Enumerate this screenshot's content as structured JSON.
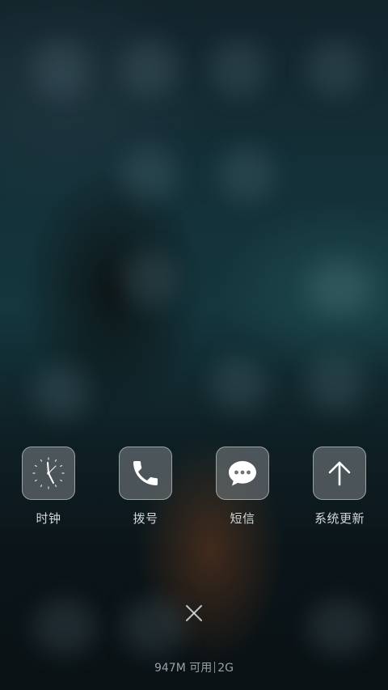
{
  "recent_apps": [
    {
      "label": "时钟",
      "icon": "clock-icon"
    },
    {
      "label": "拨号",
      "icon": "phone-icon"
    },
    {
      "label": "短信",
      "icon": "message-icon"
    },
    {
      "label": "系统更新",
      "icon": "arrow-up-icon"
    }
  ],
  "close_icon": "close-icon",
  "memory": {
    "available": "947M 可用",
    "total": "2G"
  }
}
